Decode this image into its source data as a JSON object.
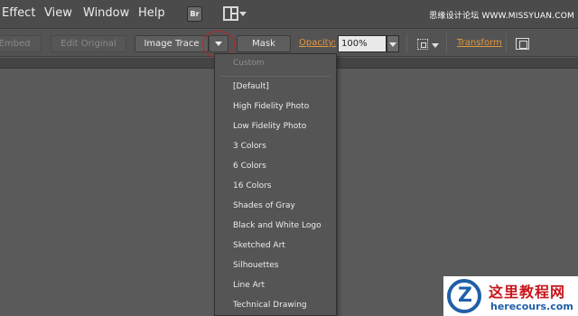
{
  "menubar": {
    "items": [
      "Effect",
      "View",
      "Window",
      "Help"
    ],
    "bridge_label": "Br",
    "watermark": "思缘设计论坛 WWW.MISSYUAN.COM"
  },
  "controlbar": {
    "embed_label": "Embed",
    "edit_original_label": "Edit Original",
    "image_trace_label": "Image Trace",
    "mask_label": "Mask",
    "opacity_label": "Opacity:",
    "opacity_value": "100%",
    "transform_label": "Transform"
  },
  "trace_menu": {
    "header": "Custom",
    "presets": [
      "[Default]",
      "High Fidelity Photo",
      "Low Fidelity Photo",
      "3 Colors",
      "6 Colors",
      "16 Colors",
      "Shades of Gray",
      "Black and White Logo",
      "Sketched Art",
      "Silhouettes",
      "Line Art",
      "Technical Drawing"
    ]
  },
  "logo": {
    "title": "这里教程网",
    "url": "herecours.com"
  },
  "colors": {
    "accent_orange": "#e3973a",
    "highlight_ring": "#b3262a",
    "logo_blue": "#1f5fa8",
    "logo_red": "#c8161d"
  }
}
